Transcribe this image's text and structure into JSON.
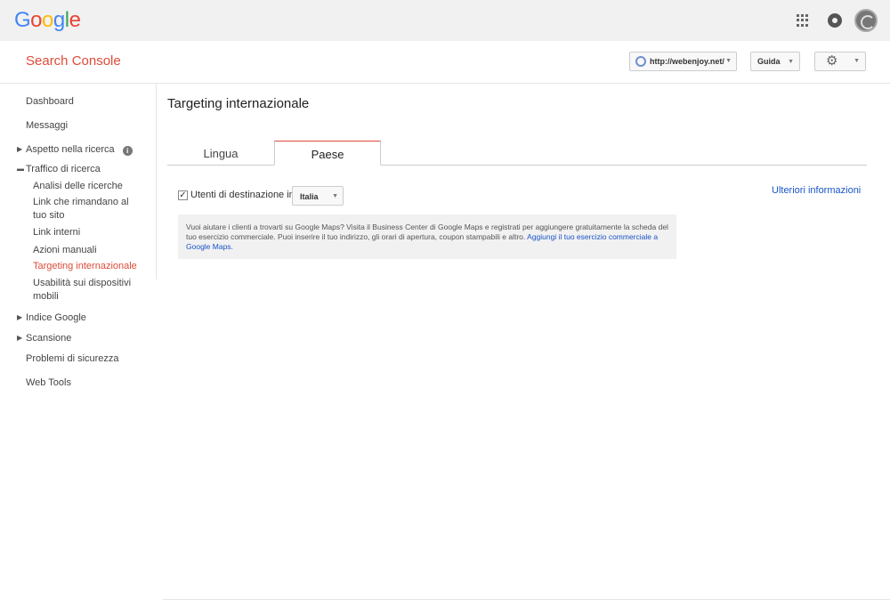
{
  "topbar": {
    "logo_letters": [
      {
        "char": "G",
        "color": "#4285F4"
      },
      {
        "char": "o",
        "color": "#EA4335"
      },
      {
        "char": "o",
        "color": "#FBBC05"
      },
      {
        "char": "g",
        "color": "#4285F4"
      },
      {
        "char": "l",
        "color": "#34A853"
      },
      {
        "char": "e",
        "color": "#EA4335"
      }
    ],
    "icons": [
      "apps-grid-icon",
      "notifications-icon",
      "account-avatar"
    ]
  },
  "product": {
    "title": "Search Console",
    "site_url": "http://webenjoy.net/",
    "help_label": "Guida",
    "accent_color": "#dd4b39"
  },
  "sidebar": {
    "dashboard": "Dashboard",
    "messages": "Messaggi",
    "search_appearance": "Aspetto nella ricerca",
    "search_traffic": "Traffico di ricerca",
    "search_traffic_items": [
      "Analisi delle ricerche",
      "Link che rimandano al tuo sito",
      "Link interni",
      "Azioni manuali",
      "Targeting internazionale",
      "Usabilità sui dispositivi mobili"
    ],
    "google_index": "Indice Google",
    "crawl": "Scansione",
    "security": "Problemi di sicurezza",
    "web_tools": "Web Tools"
  },
  "main": {
    "title": "Targeting internazionale",
    "tabs": [
      {
        "label": "Lingua"
      },
      {
        "label": "Paese"
      }
    ],
    "target_label": "Utenti di destinazione in:",
    "target_checked": true,
    "country": "Italia",
    "more_info": "Ulteriori informazioni",
    "maps_text": "Vuoi aiutare i clienti a trovarti su Google Maps? Visita il Business Center di Google Maps e registrati per aggiungere gratuitamente la scheda del tuo esercizio commerciale. Puoi inserire il tuo indirizzo, gli orari di apertura, coupon stampabili e altro. ",
    "maps_link": "Aggiungi il tuo esercizio commerciale a Google Maps."
  }
}
